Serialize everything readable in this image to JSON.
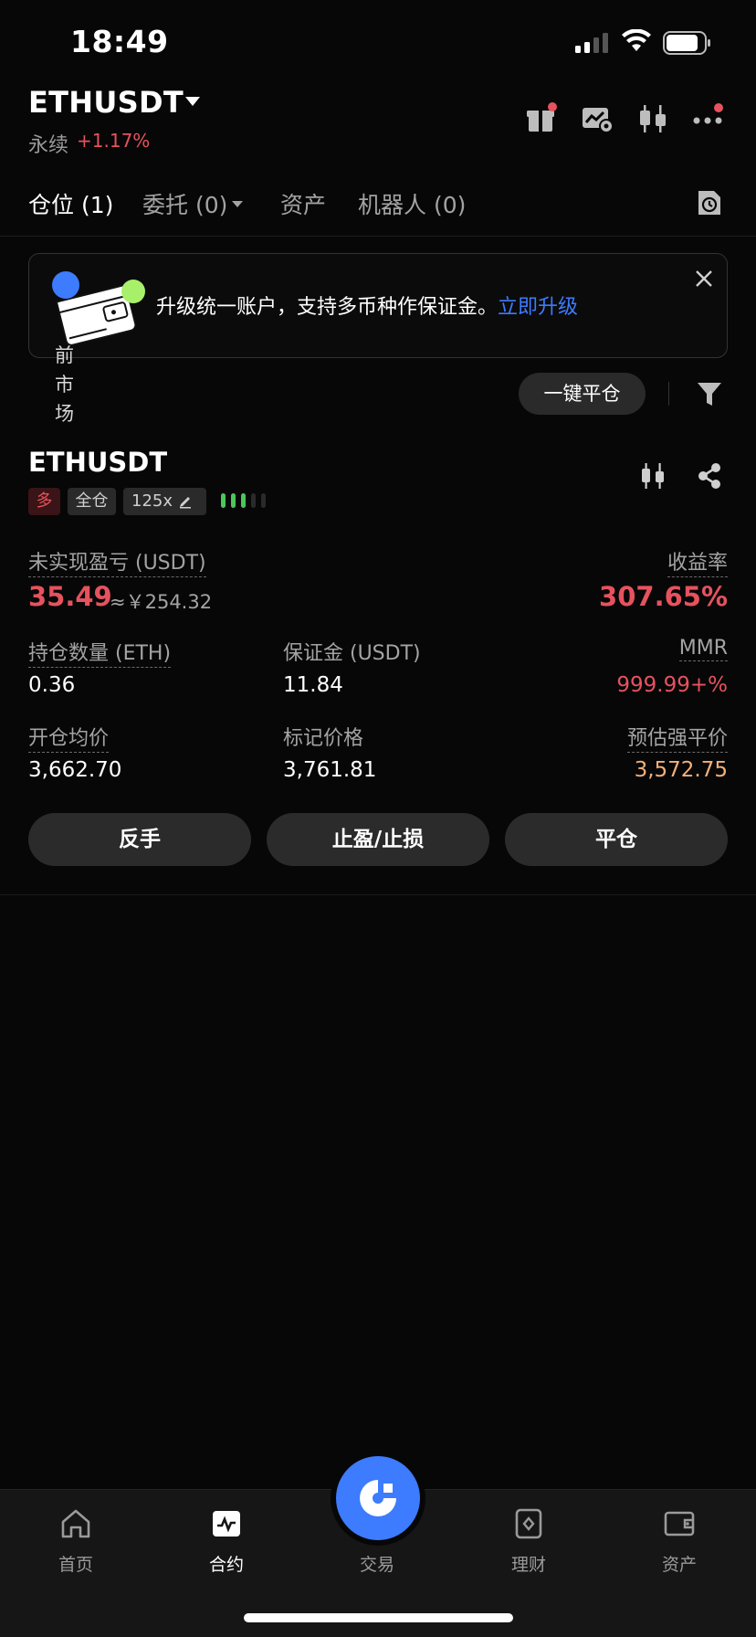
{
  "status_bar": {
    "time": "18:49"
  },
  "header": {
    "symbol": "ETHUSDT",
    "contract_type": "永续",
    "change": "+1.17%"
  },
  "tabs": [
    {
      "label": "仓位 (1)",
      "active": true
    },
    {
      "label": "委托 (0)",
      "active": false
    },
    {
      "label": "资产",
      "active": false
    },
    {
      "label": "机器人 (0)",
      "active": false
    }
  ],
  "banner": {
    "text": "升级统一账户，支持多币种作保证金。",
    "link": "立即升级"
  },
  "market_filter": {
    "chars": [
      "前",
      "市",
      "场"
    ]
  },
  "actions_bar": {
    "close_all": "一键平仓"
  },
  "position": {
    "symbol": "ETHUSDT",
    "side": "多",
    "margin_mode": "全仓",
    "leverage": "125x",
    "adl_level": 3,
    "unrealized_pnl_label": "未实现盈亏 (USDT)",
    "unrealized_pnl": "35.49",
    "unrealized_pnl_cny": "≈￥254.32",
    "roe_label": "收益率",
    "roe": "307.65%",
    "qty_label": "持仓数量 (ETH)",
    "qty": "0.36",
    "margin_label": "保证金 (USDT)",
    "margin": "11.84",
    "mmr_label": "MMR",
    "mmr": "999.99+%",
    "entry_label": "开仓均价",
    "entry": "3,662.70",
    "mark_label": "标记价格",
    "mark": "3,761.81",
    "liq_label": "预估强平价",
    "liq": "3,572.75"
  },
  "position_actions": {
    "reverse": "反手",
    "tpsl": "止盈/止损",
    "close": "平仓"
  },
  "bottom_nav": {
    "home": "首页",
    "futures": "合约",
    "trade": "交易",
    "earn": "理财",
    "assets": "资产"
  },
  "colors": {
    "background": "#070707",
    "up_red": "#e6525e",
    "liq_orange": "#f3b07a",
    "accent_blue": "#3d7bff",
    "adl_green": "#4cc75a"
  }
}
